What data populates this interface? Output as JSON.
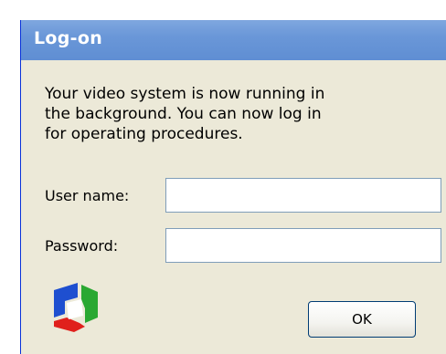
{
  "window": {
    "title": "Log-on",
    "title_bar_color": "#6a97d8",
    "background_color": "#ece9d8"
  },
  "message": {
    "lines": [
      "Your video system is now running in",
      "the background. You can now log in",
      "for operating procedures."
    ]
  },
  "form": {
    "username_label": "User name:",
    "username_value": "",
    "password_label": "Password:",
    "password_value": ""
  },
  "logo": {
    "icon": "colored-cube-logo-icon",
    "colors": [
      "#1e4fd0",
      "#e0201c",
      "#2aa832",
      "#ffffff"
    ]
  },
  "buttons": {
    "ok_label": "OK"
  }
}
